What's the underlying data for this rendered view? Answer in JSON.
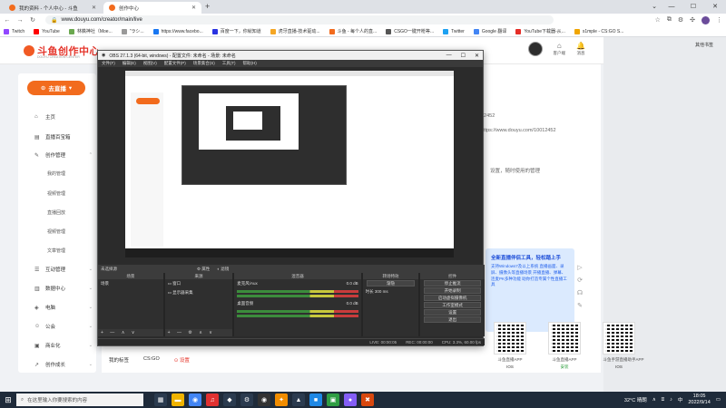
{
  "browser": {
    "tabs": [
      {
        "title": "我的资料 - 个人中心 - 斗鱼",
        "active": false
      },
      {
        "title": "创作中心",
        "active": true
      }
    ],
    "address": "www.douyu.com/creator/main/live",
    "bookmarks": [
      "Twitch",
      "YouTube",
      "林檎神社（Moe...",
      "\"ラシ...",
      "https://www.facebo...",
      "百度一下，你就知道",
      "虎牙直播-技术驱动...",
      "斗鱼 - 每个人的直...",
      "CSGO一键开枪等...",
      "Twitter",
      "Google 翻译",
      "YouTube下载器-从...",
      "s1mple - CS:GO S..."
    ],
    "right_bar": "其他书签"
  },
  "header": {
    "logo_name": "斗鱼创作中心",
    "logo_sub": "DOUYU CREATION CENTER",
    "icons": [
      {
        "icon": "bell-icon",
        "label": "客户端"
      },
      {
        "icon": "message-icon",
        "label": "消息"
      }
    ]
  },
  "sidebar": {
    "live_button": "去直播",
    "items": [
      {
        "icon": "home-icon",
        "label": "主页"
      },
      {
        "icon": "book-icon",
        "label": "直播百宝箱"
      },
      {
        "icon": "edit-icon",
        "label": "创作管理",
        "expanded": true
      },
      {
        "icon": "",
        "label": "我的管理",
        "sub": true
      },
      {
        "icon": "",
        "label": "视频管理",
        "sub": true
      },
      {
        "icon": "",
        "label": "直播回放",
        "sub": true
      },
      {
        "icon": "",
        "label": "视频管理",
        "sub": true
      },
      {
        "icon": "",
        "label": "文章管理",
        "sub": true
      },
      {
        "icon": "chat-icon",
        "label": "互动管理"
      },
      {
        "icon": "chart-icon",
        "label": "数据中心"
      },
      {
        "icon": "gift-icon",
        "label": "电脑"
      },
      {
        "icon": "group-icon",
        "label": "公会"
      },
      {
        "icon": "shop-icon",
        "label": "商业化"
      },
      {
        "icon": "grow-icon",
        "label": "创作成长"
      }
    ]
  },
  "content": {
    "username": "lll",
    "code": "12452",
    "room_url": "https://www.douyu.com/10012452",
    "settings_link": "设置，随时使用的管理",
    "promo_title": "全新直播伴侣工具，轻松踏上手",
    "promo_text": "支持Windows7及以上系统 直播画面、录屏、摄像头等直播场景 开播直播、弹幕、连麦PK多种功能 助你打造专属个性直播工具",
    "apps": [
      {
        "name": "斗鱼直播APP",
        "platform": "IOS"
      },
      {
        "name": "斗鱼直播APP",
        "platform": "安装"
      },
      {
        "name": "斗鱼手游直播助手APP",
        "platform": "IOS"
      }
    ],
    "bottom_tabs": [
      "我的标签",
      "CS:GO",
      "设置"
    ]
  },
  "obs": {
    "title": "OBS 27.1.3 (64-bit, windows) - 配置文件: 未命名 - 场景: 未命名",
    "menu": [
      "文件(F)",
      "编辑(E)",
      "视图(V)",
      "配置文件(P)",
      "场景集合(S)",
      "工具(T)",
      "帮助(H)"
    ],
    "source_bar": [
      "未选择源",
      "属性",
      "滤镜"
    ],
    "docks": {
      "scenes": {
        "header": "场景",
        "items": [
          "场景"
        ]
      },
      "sources": {
        "header": "来源",
        "items": [
          "窗口",
          "显示器采集"
        ]
      },
      "mixer": {
        "header": "混音器",
        "channels": [
          {
            "name": "桌面音频",
            "db": "0.0 dB"
          },
          {
            "name": "麦克风/Aux",
            "db": "0.0 dB"
          }
        ]
      },
      "transitions": {
        "header": "转场特效",
        "type": "渐隐",
        "duration_label": "时长",
        "duration": "300 ms"
      },
      "controls": {
        "header": "控件",
        "buttons": [
          "停止推流",
          "开始录制",
          "启动虚拟摄像机",
          "工作室模式",
          "设置",
          "退出"
        ]
      }
    },
    "status": [
      "LIVE: 00:00:05",
      "REC: 00:00:00",
      "CPU: 3.3%, 60.00 fps"
    ]
  },
  "taskbar": {
    "search_placeholder": "在这里输入你要搜索的内容",
    "temp": "32°C 晴朗",
    "time": "18:05",
    "date": "2022/9/14"
  }
}
